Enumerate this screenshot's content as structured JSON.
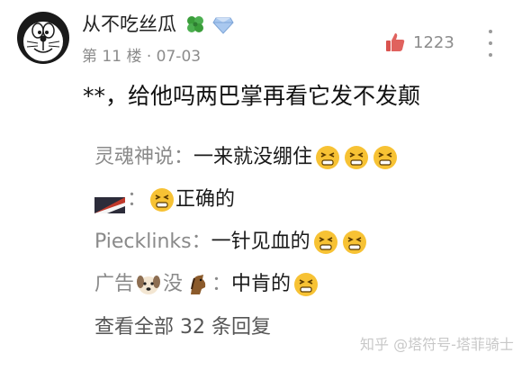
{
  "comment": {
    "username": "从不吃丝瓜",
    "floor": "第 11 楼",
    "date": "07-03",
    "likes": "1223",
    "text": "**，给他吗两巴掌再看它发不发颠"
  },
  "replies": [
    {
      "author": "灵魂神说",
      "sep": "：",
      "text": "一来就没绷住",
      "emoji_count": 3
    },
    {
      "author_icon": "flag-avatar-icon",
      "sep": "：",
      "text": "正确的",
      "emoji_before": true
    },
    {
      "author": "Piecklinks",
      "sep": "：",
      "text": "一针见血的",
      "emoji_count": 2
    },
    {
      "author": "广告",
      "author_icon": "dog-icon",
      "author_suffix": "没",
      "author_icon_2": "horse-icon",
      "sep": "：",
      "text": "中肯的",
      "emoji_count": 1
    }
  ],
  "view_all": "查看全部 32 条回复",
  "watermark": "知乎 @塔符号-塔菲骑士",
  "colors": {
    "like_red": "#d9534f",
    "clover_green": "#3a9d3a",
    "gem_blue": "#8fb7e8",
    "emoji_yellow": "#f7c234",
    "meta_gray": "#8c8c8c"
  }
}
